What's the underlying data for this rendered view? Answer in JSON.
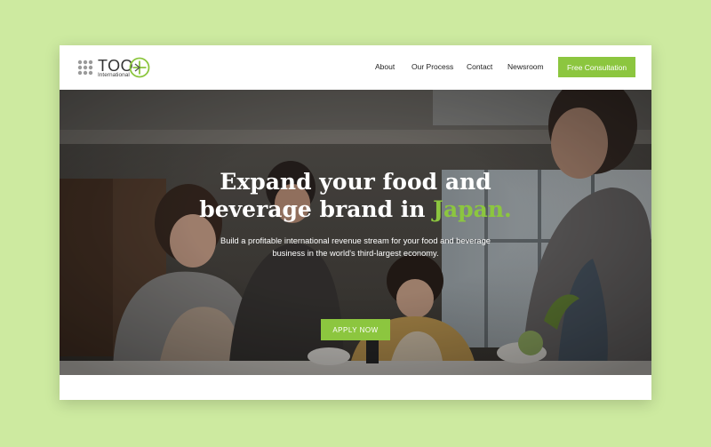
{
  "brand": {
    "name": "TOO",
    "sub": "International",
    "accent_color": "#8cc63f"
  },
  "nav": {
    "items": [
      {
        "label": "About"
      },
      {
        "label": "Our Process"
      },
      {
        "label": "Contact"
      },
      {
        "label": "Newsroom"
      }
    ],
    "cta_label": "Free Consultation"
  },
  "hero": {
    "title_line1": "Expand your food and",
    "title_line2_prefix": "beverage brand in ",
    "title_line2_accent": "Japan.",
    "subtitle_line1": "Build a profitable international revenue stream for your food and beverage",
    "subtitle_line2": "business in the world's third-largest economy.",
    "button_label": "APPLY NOW"
  }
}
